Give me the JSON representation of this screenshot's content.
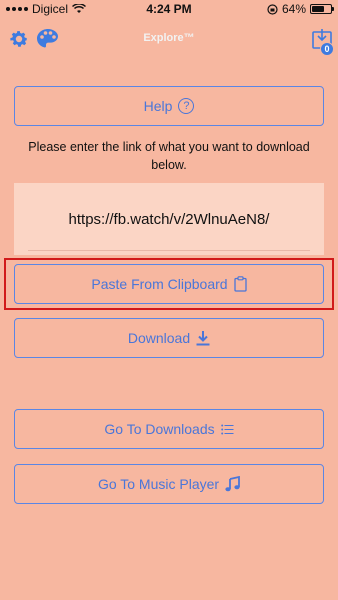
{
  "status": {
    "carrier": "Digicel",
    "time": "4:24 PM",
    "battery": "64%",
    "battery_level": 0.64
  },
  "nav": {
    "title": "Explore™",
    "download_badge": "0"
  },
  "help_label": "Help",
  "help_icon_glyph": "?",
  "instructions": "Please enter the link of what you want to download below.",
  "link_value": "https://fb.watch/v/2WlnuAeN8/",
  "buttons": {
    "paste": "Paste From Clipboard",
    "download": "Download",
    "go_to_downloads": "Go To Downloads",
    "go_to_music": "Go To Music Player"
  },
  "colors": {
    "background": "#F7B7A0",
    "accent": "#4A76D9",
    "highlight": "#D11A1A",
    "badge": "#3E7BE0"
  },
  "icons": {
    "settings": "gear-icon",
    "theme": "palette-icon",
    "downloads": "download-tray-icon",
    "help": "question-circle-icon",
    "paste": "clipboard-icon",
    "download": "download-arrow-icon",
    "list": "list-icon",
    "music": "music-note-icon"
  }
}
